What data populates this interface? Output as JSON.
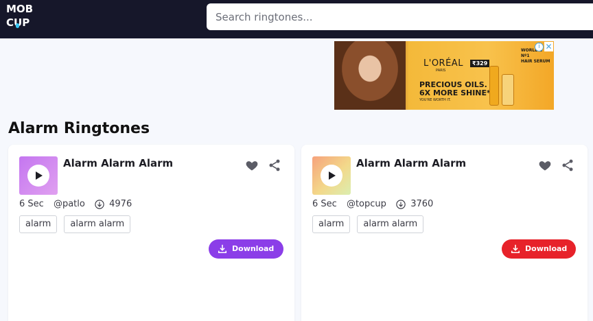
{
  "header": {
    "logo_line1": "MOB",
    "logo_line2": "CUP",
    "search_placeholder": "Search ringtones..."
  },
  "ad": {
    "brand": "L'ORÉAL",
    "brand_sub": "PARIS",
    "price": "₹329",
    "headline_line1": "PRECIOUS OILS.",
    "headline_line2": "6X MORE SHINE*",
    "tagline": "YOU'RE WORTH IT.",
    "right_line1": "WORLD'S",
    "right_line2": "Nº1",
    "right_line3": "HAIR SERUM",
    "info_icon": "i",
    "close_icon": "✕"
  },
  "page": {
    "heading": "Alarm Ringtones"
  },
  "ringtones": [
    {
      "title": "Alarm Alarm Alarm",
      "duration": "6 Sec",
      "author": "@patlo",
      "downloads": "4976",
      "tags": [
        "alarm",
        "alarm alarm"
      ],
      "download_label": "Download",
      "accent": "#8b3ee8"
    },
    {
      "title": "Alarm Alarm Alarm",
      "duration": "6 Sec",
      "author": "@topcup",
      "downloads": "3760",
      "tags": [
        "alarm",
        "alarm alarm"
      ],
      "download_label": "Download",
      "accent": "#e7222a"
    }
  ],
  "colors": {
    "topbar": "#16172a",
    "logo_accent": "#38c6f4",
    "page_bg": "#f6f8fd"
  }
}
